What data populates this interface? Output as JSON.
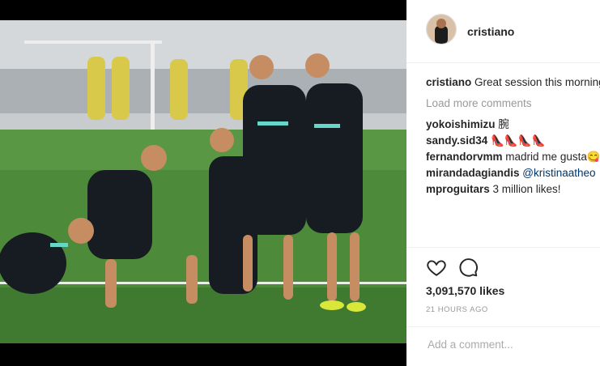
{
  "post": {
    "username": "cristiano",
    "caption_user": "cristiano",
    "caption_text": "Great session this morning! Winning team",
    "load_more_label": "Load more comments",
    "comments": [
      {
        "user": "yokoishimizu",
        "text": "腕"
      },
      {
        "user": "sandy.sid34",
        "text": "👠👠👠👠"
      },
      {
        "user": "fernandorvmm",
        "text": "madrid me gusta😋😋😋😋😋😋😋😋"
      },
      {
        "user": "mirandadagiandis",
        "text": "@kristinaatheo"
      },
      {
        "user": "mproguitars",
        "text": "3 million likes!"
      }
    ],
    "likes": "3,091,570 likes",
    "time": "21 HOURS AGO",
    "add_comment_placeholder": "Add a comment..."
  },
  "icons": {
    "like": "heart-icon",
    "comment": "comment-bubble-icon"
  }
}
